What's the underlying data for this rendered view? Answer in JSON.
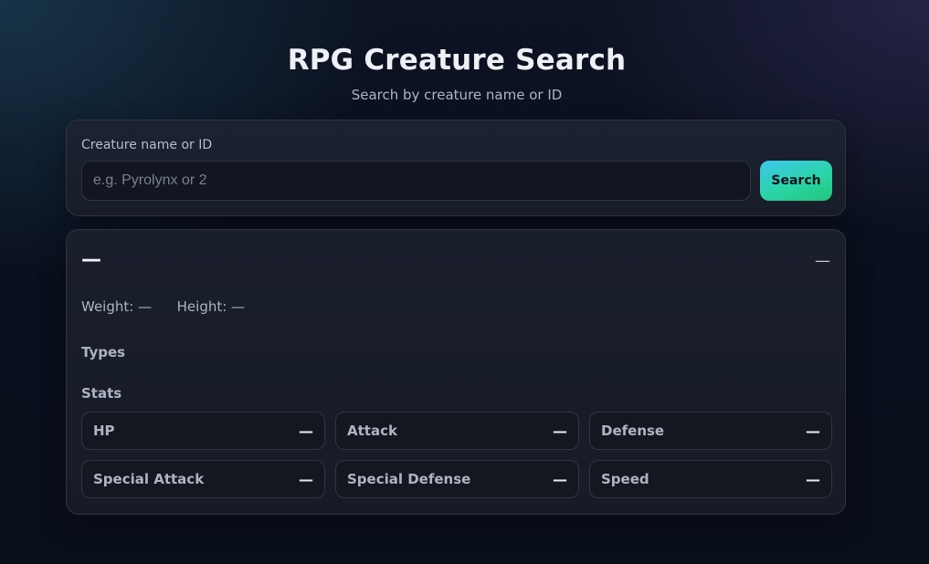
{
  "header": {
    "title": "RPG Creature Search",
    "subtitle": "Search by creature name or ID"
  },
  "search": {
    "label": "Creature name or ID",
    "value": "",
    "placeholder": "e.g. Pyrolynx or 2",
    "button_label": "Search"
  },
  "creature": {
    "name": "—",
    "id": "—",
    "weight_label": "Weight:",
    "weight_value": "—",
    "height_label": "Height:",
    "height_value": "—",
    "types_heading": "Types",
    "types": [],
    "stats_heading": "Stats",
    "stats": [
      {
        "label": "HP",
        "value": "—"
      },
      {
        "label": "Attack",
        "value": "—"
      },
      {
        "label": "Defense",
        "value": "—"
      },
      {
        "label": "Special Attack",
        "value": "—"
      },
      {
        "label": "Special Defense",
        "value": "—"
      },
      {
        "label": "Speed",
        "value": "—"
      }
    ]
  },
  "colors": {
    "accent_start": "#3fc7ee",
    "accent_end": "#22c67a",
    "background": "#0a0f1d",
    "card": "#1a1f2c"
  }
}
